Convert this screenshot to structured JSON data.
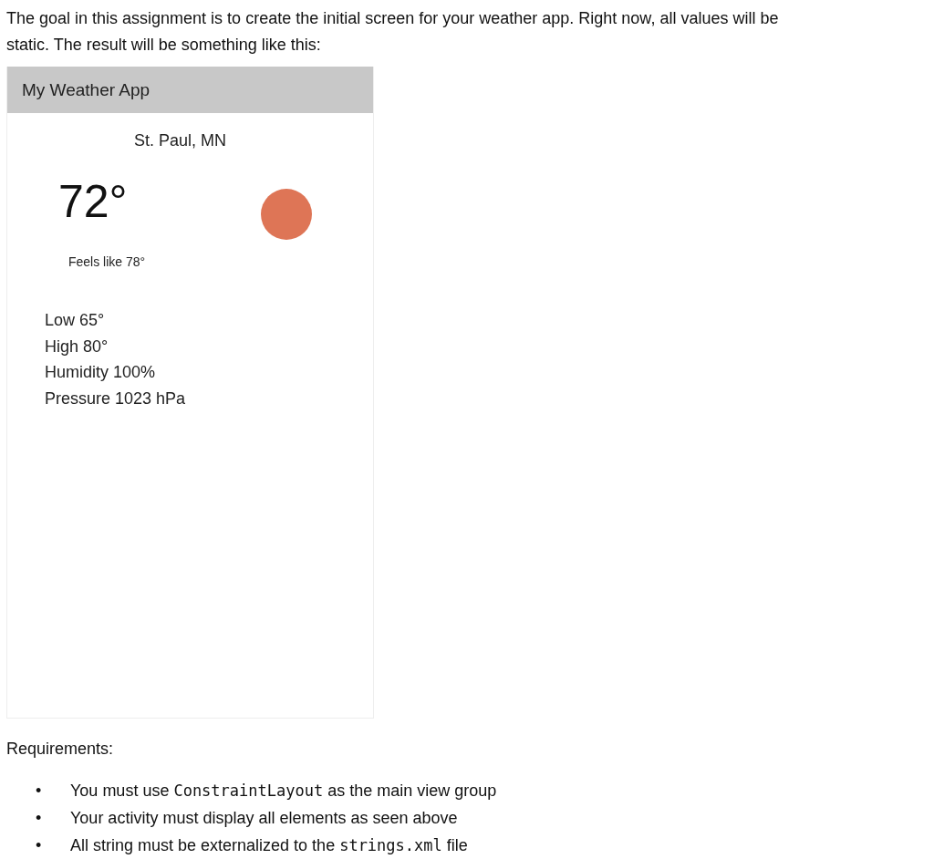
{
  "intro": "The goal in this assignment is to create the initial screen for your weather app. Right now, all values will be static. The result will be something like this:",
  "app": {
    "title": "My Weather App",
    "location": "St. Paul, MN",
    "temperature": "72°",
    "feels_like": "Feels like 78°",
    "stats": [
      "Low 65°",
      "High 80°",
      "Humidity 100%",
      "Pressure 1023 hPa"
    ]
  },
  "requirements_heading": "Requirements:",
  "requirements": [
    {
      "bullet": "•",
      "parts": [
        {
          "kind": "plain",
          "text": "You must use "
        },
        {
          "kind": "code",
          "text": "ConstraintLayout"
        },
        {
          "kind": "plain",
          "text": " as the main view group"
        }
      ]
    },
    {
      "bullet": "•",
      "parts": [
        {
          "kind": "plain",
          "text": "Your activity must display all elements as seen above"
        }
      ]
    },
    {
      "bullet": "•",
      "parts": [
        {
          "kind": "plain",
          "text": "All string must be externalized to the "
        },
        {
          "kind": "code",
          "text": "strings.xml"
        },
        {
          "kind": "plain",
          "text": " file"
        }
      ]
    }
  ]
}
